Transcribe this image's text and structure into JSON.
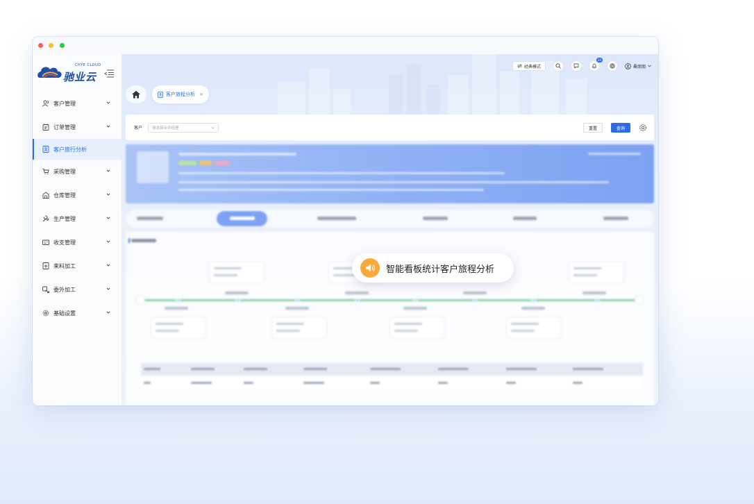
{
  "brand": {
    "logo_text": "驰业云",
    "logo_sub": "CHYE CLOUD",
    "brand_color": "#1b4fa8",
    "accent_color": "#2c6de4"
  },
  "window_controls": [
    "close",
    "minimize",
    "maximize"
  ],
  "sidebar": {
    "items": [
      {
        "label": "客户管理",
        "icon": "user-icon",
        "expandable": true,
        "active": false
      },
      {
        "label": "订单管理",
        "icon": "order-icon",
        "expandable": true,
        "active": false
      },
      {
        "label": "客户旅行分析",
        "icon": "journey-icon",
        "expandable": false,
        "active": true
      },
      {
        "label": "采购管理",
        "icon": "cart-icon",
        "expandable": true,
        "active": false
      },
      {
        "label": "仓库管理",
        "icon": "warehouse-icon",
        "expandable": true,
        "active": false
      },
      {
        "label": "生产管理",
        "icon": "tools-icon",
        "expandable": true,
        "active": false
      },
      {
        "label": "收支管理",
        "icon": "finance-icon",
        "expandable": true,
        "active": false
      },
      {
        "label": "来料加工",
        "icon": "material-icon",
        "expandable": true,
        "active": false
      },
      {
        "label": "委外加工",
        "icon": "outsource-icon",
        "expandable": true,
        "active": false
      },
      {
        "label": "基础设置",
        "icon": "gear-icon",
        "expandable": true,
        "active": false
      }
    ]
  },
  "header": {
    "classic_mode": "经典模式",
    "notification_count": "24",
    "username": "桑朋朋"
  },
  "tabs": {
    "active": {
      "label": "客户旅程分析",
      "icon": "journey-icon"
    }
  },
  "filter": {
    "label": "客户",
    "placeholder": "请选择业务经理",
    "reset": "重置",
    "query": "查询"
  },
  "overlay": {
    "text": "智能看板统计客户旅程分析",
    "icon": "speaker-icon",
    "icon_color": "#f7a93b"
  }
}
